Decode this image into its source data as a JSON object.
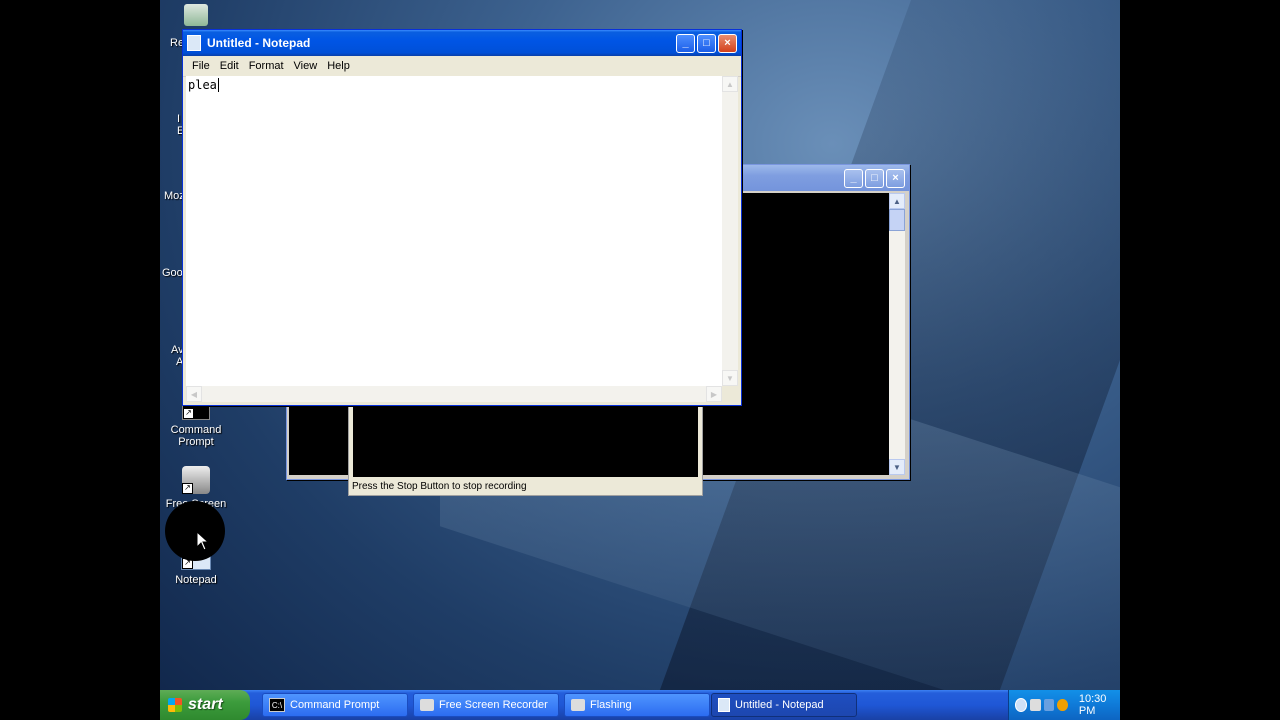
{
  "desktop": {
    "icons": [
      {
        "label": "Command\nPrompt",
        "icon": "command-prompt-icon"
      },
      {
        "label": "Free Screen",
        "icon": "free-screen-recorder-icon"
      },
      {
        "label": "Notepad",
        "icon": "notepad-icon"
      }
    ],
    "partial_labels": [
      "Re",
      "I",
      "E",
      "Moz",
      "Goo",
      "Av",
      "A"
    ]
  },
  "notepad": {
    "title": "Untitled - Notepad",
    "menu": [
      "File",
      "Edit",
      "Format",
      "View",
      "Help"
    ],
    "content": "plea"
  },
  "recorder": {
    "status": "Press the Stop Button to stop recording"
  },
  "taskbar": {
    "start_label": "start",
    "items": [
      {
        "label": "Command Prompt",
        "icon": "cmd-icon",
        "active": false
      },
      {
        "label": "Free Screen Recorder",
        "icon": "camera-icon",
        "active": false
      },
      {
        "label": "Flashing",
        "icon": "camera-icon",
        "active": false
      },
      {
        "label": "Untitled - Notepad",
        "icon": "notepad-icon",
        "active": true
      }
    ],
    "clock": "10:30 PM"
  },
  "colors": {
    "titlebar": "#0055e5",
    "taskbar": "#245edb",
    "start": "#3c9c3c"
  }
}
